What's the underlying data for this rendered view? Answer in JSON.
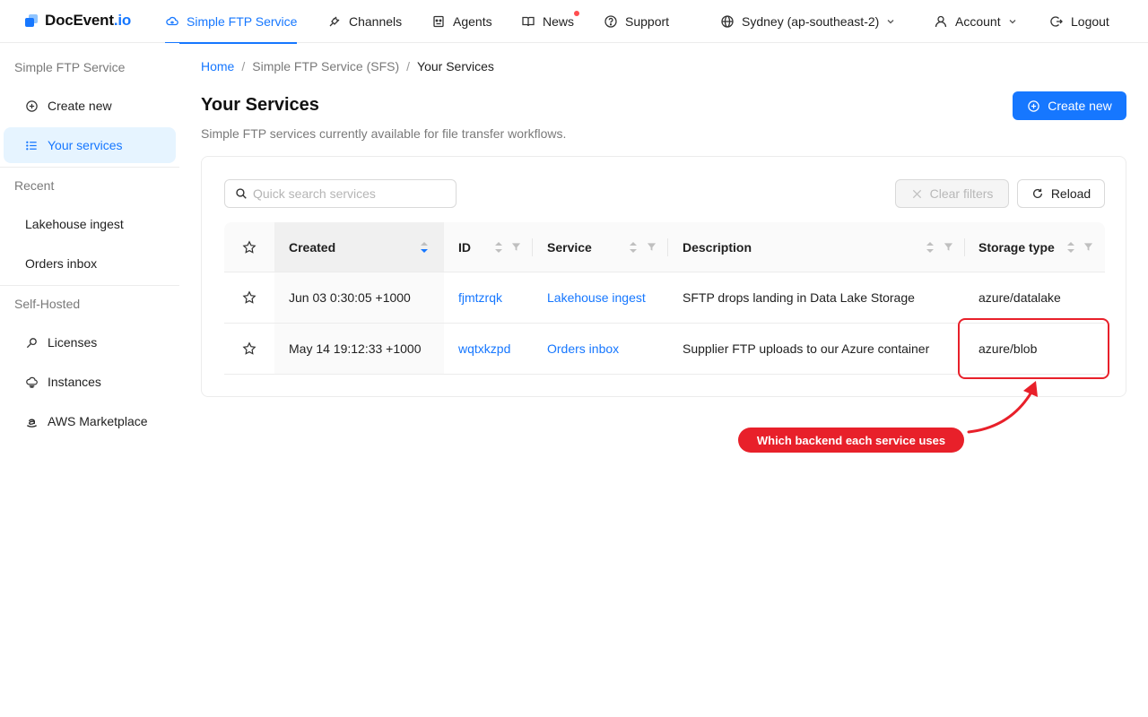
{
  "brand": {
    "name": "DocEvent",
    "suffix": ".io"
  },
  "nav": {
    "items": [
      {
        "label": "Simple FTP Service",
        "icon": "cloud-icon",
        "active": true
      },
      {
        "label": "Channels",
        "icon": "plug-icon"
      },
      {
        "label": "Agents",
        "icon": "robot-icon"
      },
      {
        "label": "News",
        "icon": "book-icon",
        "badge": "dot"
      },
      {
        "label": "Support",
        "icon": "question-circle-icon"
      }
    ],
    "region": "Sydney (ap-southeast-2)",
    "account": "Account",
    "logout": "Logout"
  },
  "sidebar": {
    "groups": [
      {
        "title": "Simple FTP Service",
        "items": [
          {
            "label": "Create new",
            "icon": "plus-circle-icon"
          },
          {
            "label": "Your services",
            "icon": "list-icon",
            "active": true
          }
        ]
      },
      {
        "title": "Recent",
        "items": [
          {
            "label": "Lakehouse ingest"
          },
          {
            "label": "Orders inbox"
          }
        ]
      },
      {
        "title": "Self-Hosted",
        "items": [
          {
            "label": "Licenses",
            "icon": "key-icon"
          },
          {
            "label": "Instances",
            "icon": "cloud-server-icon"
          },
          {
            "label": "AWS Marketplace",
            "icon": "amazon-icon"
          }
        ]
      }
    ]
  },
  "breadcrumb": {
    "home": "Home",
    "section": "Simple FTP Service (SFS)",
    "current": "Your Services",
    "sep": "/"
  },
  "page": {
    "title": "Your Services",
    "subtitle": "Simple FTP services currently available for file transfer workflows.",
    "create_button": "Create new"
  },
  "toolbar": {
    "search_placeholder": "Quick search services",
    "clear_filters": "Clear filters",
    "reload": "Reload"
  },
  "table": {
    "columns": [
      "Created",
      "ID",
      "Service",
      "Description",
      "Storage type"
    ],
    "rows": [
      {
        "created": "Jun 03 0:30:05 +1000",
        "id": "fjmtzrqk",
        "service": "Lakehouse ingest",
        "description": "SFTP drops landing in Data Lake Storage",
        "storage": "azure/datalake"
      },
      {
        "created": "May 14 19:12:33 +1000",
        "id": "wqtxkzpd",
        "service": "Orders inbox",
        "description": "Supplier FTP uploads to our Azure container",
        "storage": "azure/blob"
      }
    ]
  },
  "annotation": {
    "text": "Which backend each service uses",
    "color": "#e8202a"
  },
  "colors": {
    "primary": "#1677ff",
    "active_bg": "#e6f4ff"
  }
}
